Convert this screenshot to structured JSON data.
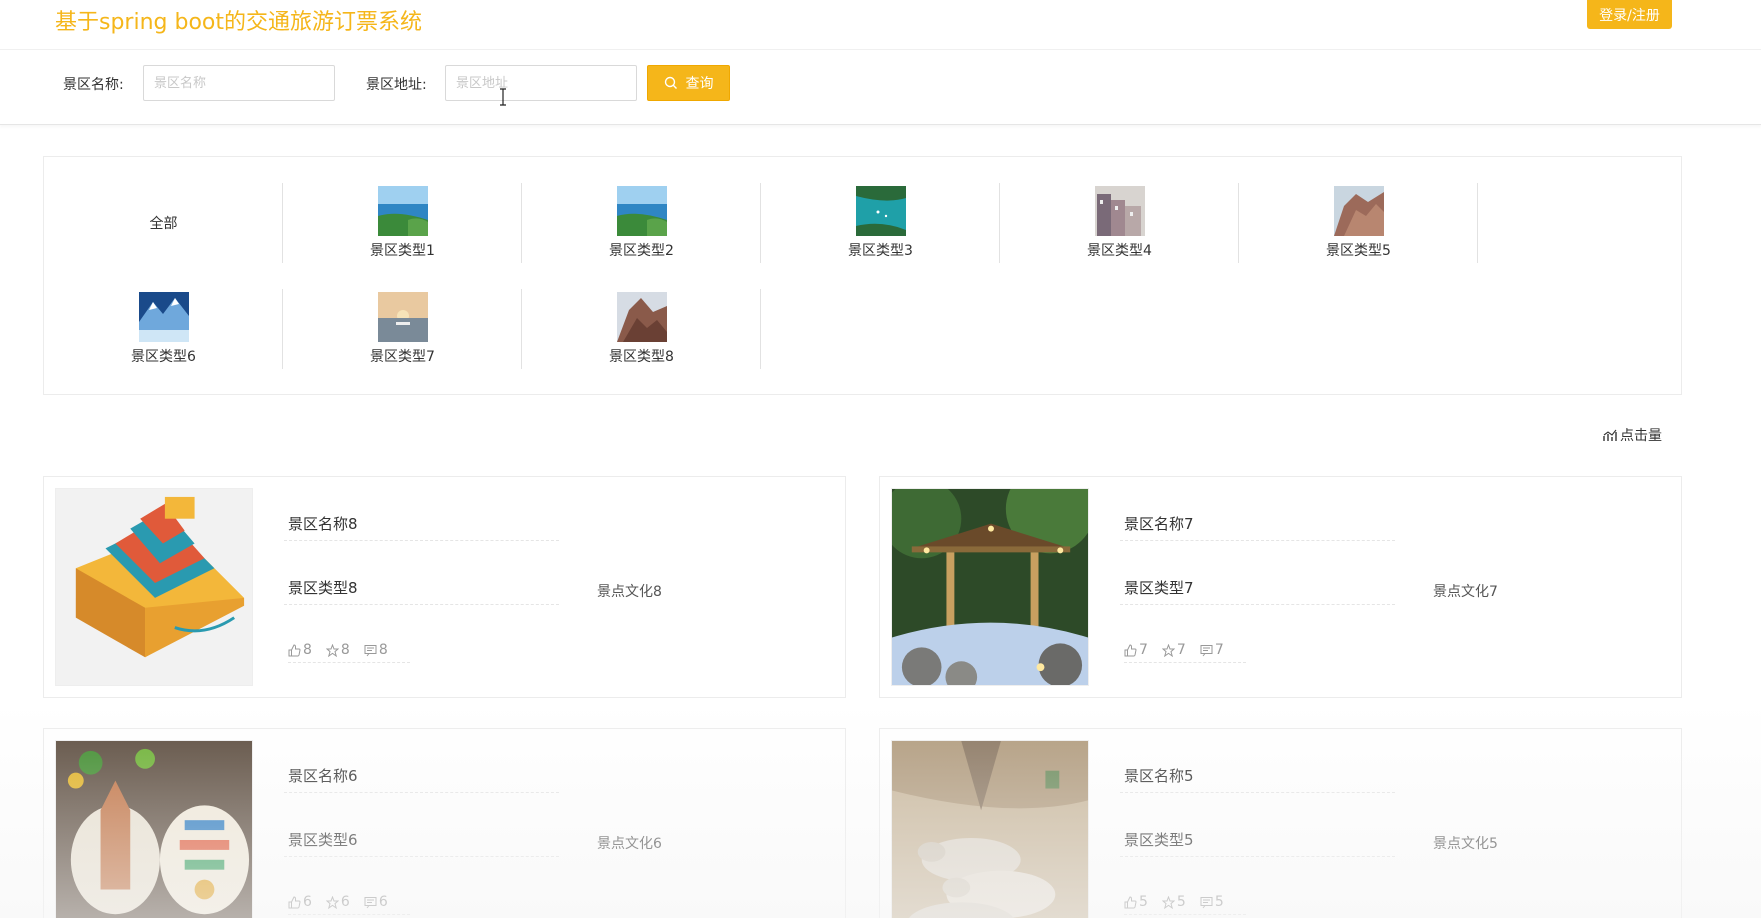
{
  "header": {
    "title": "基于spring boot的交通旅游订票系统",
    "login_label": "登录/注册"
  },
  "search": {
    "name_label": "景区名称:",
    "name_placeholder": "景区名称",
    "address_label": "景区地址:",
    "address_placeholder": "景区地址",
    "button_label": "查询"
  },
  "categories": {
    "all_label": "全部",
    "items": [
      {
        "label": "景区类型1",
        "icon": "coast-photo"
      },
      {
        "label": "景区类型2",
        "icon": "coast-photo"
      },
      {
        "label": "景区类型3",
        "icon": "bay-photo"
      },
      {
        "label": "景区类型4",
        "icon": "town-photo"
      },
      {
        "label": "景区类型5",
        "icon": "cliff-photo"
      },
      {
        "label": "景区类型6",
        "icon": "ice-mountain-photo"
      },
      {
        "label": "景区类型7",
        "icon": "sunset-sea-photo"
      },
      {
        "label": "景区类型8",
        "icon": "rock-mountain-photo"
      }
    ]
  },
  "sort": {
    "label": "点击量"
  },
  "cards": [
    {
      "name": "景区名称8",
      "type": "景区类型8",
      "culture": "景点文化8",
      "likes": "8",
      "favorites": "8",
      "comments": "8",
      "image": "pagoda-model-photo"
    },
    {
      "name": "景区名称7",
      "type": "景区类型7",
      "culture": "景点文化7",
      "likes": "7",
      "favorites": "7",
      "comments": "7",
      "image": "hot-spring-photo"
    },
    {
      "name": "景区名称6",
      "type": "景区类型6",
      "culture": "景点文化6",
      "likes": "6",
      "favorites": "6",
      "comments": "6",
      "image": "fridge-magnets-photo"
    },
    {
      "name": "景区名称5",
      "type": "景区类型5",
      "culture": "景点文化5",
      "likes": "5",
      "favorites": "5",
      "comments": "5",
      "image": "terracotta-horses-photo"
    }
  ],
  "colors": {
    "accent": "#f5b61a"
  }
}
